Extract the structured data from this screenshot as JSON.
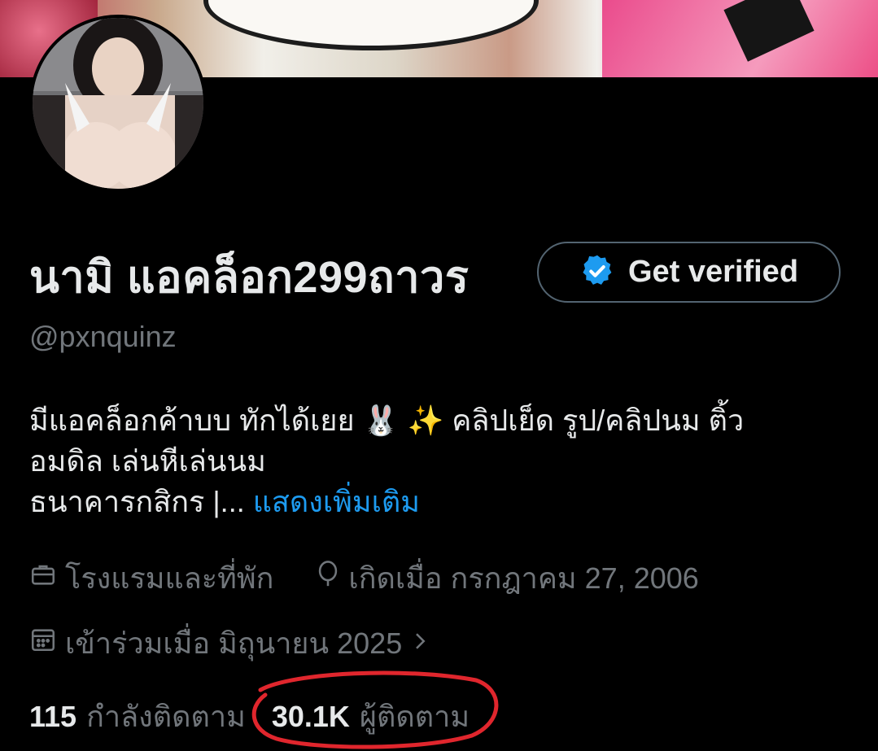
{
  "profile": {
    "display_name": "นามิ แอคล็อก299ถาวร",
    "handle": "@pxnquinz",
    "verify_button_label": "Get verified",
    "bio_line1": "มีแอคล็อกค้าบบ ทักได้เยย 🐰 ✨ คลิปเย็ด รูป/คลิปนม ติ้ว",
    "bio_line2": "อมดิล เล่นหีเล่นนม",
    "bio_line3": "ธนาคารกสิกร |...",
    "bio_more": "แสดงเพิ่มเติม",
    "category": "โรงแรมและที่พัก",
    "birthday": "เกิดเมื่อ กรกฎาคม 27, 2006",
    "joined": "เข้าร่วมเมื่อ มิถุนายน 2025",
    "following_count": "115",
    "following_label": "กำลังติดตาม",
    "followers_count": "30.1K",
    "followers_label": "ผู้ติดตาม"
  },
  "colors": {
    "background": "#000000",
    "text_primary": "#e7e9ea",
    "text_secondary": "#71767b",
    "link": "#1d9bf0",
    "verified_badge": "#1d9bf0",
    "annotation_circle": "#e0262d"
  },
  "icons": {
    "category": "briefcase-icon",
    "birthday": "balloon-icon",
    "joined": "calendar-icon",
    "joined_chevron": "chevron-right-icon",
    "verified": "verified-badge-icon"
  }
}
